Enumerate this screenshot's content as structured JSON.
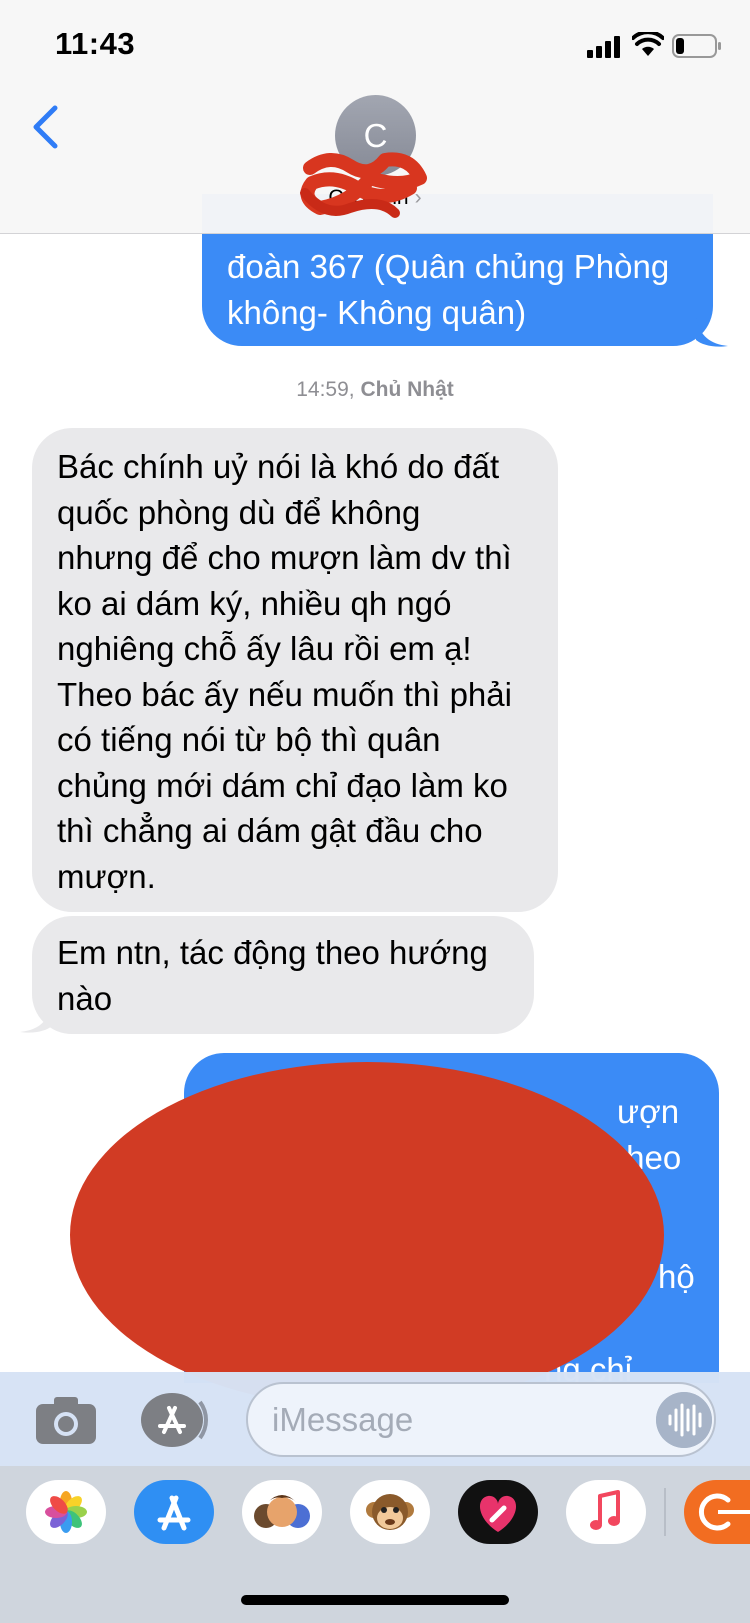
{
  "status_bar": {
    "time": "11:43"
  },
  "header": {
    "avatar_initial": "C",
    "contact_name": "C Thanh",
    "chevron": "›"
  },
  "messages": [
    {
      "direction": "outgoing",
      "text": "đoàn 367 (Quân chủng Phòng\nkhông- Không quân)"
    },
    {
      "direction": "incoming",
      "text": "Bác chính uỷ nói là khó do đất\nquốc phòng dù để không\nnhưng để cho mượn làm dv thì\nko ai dám ký, nhiều qh ngó\nnghiêng chỗ ấy lâu rồi em ạ!\nTheo bác ấy nếu muốn thì phải\ncó tiếng nói từ bộ thì quân\nchủng mới dám chỉ đạo làm ko\nthì chẳng ai dám gật đầu cho\nmượn."
    },
    {
      "direction": "incoming",
      "text": "Em ntn, tác động theo hướng\nnào"
    },
    {
      "direction": "outgoing",
      "text": ""
    }
  ],
  "timestamp": {
    "time": "14:59,",
    "day": "Chủ Nhật"
  },
  "visible_fragments": {
    "top_right": "ượn theo",
    "right_1": "hộ",
    "right_2": "ng chỉ"
  },
  "input": {
    "placeholder": "iMessage"
  },
  "icons": {
    "back": "chevron-left-icon",
    "camera": "camera-icon",
    "app_store": "app-store-icon",
    "voice": "waveform-icon",
    "signal": "cellular-signal-icon",
    "wifi": "wifi-icon",
    "battery": "battery-icon"
  },
  "app_drawer": [
    "Photos",
    "App Store",
    "Memoji",
    "Animoji",
    "Digital Touch",
    "Music",
    "Other app"
  ],
  "colors": {
    "outgoing_bubble": "#3b8bf6",
    "incoming_bubble": "#e9e9eb",
    "accent": "#2f7cf6",
    "redaction": "#d13b24"
  }
}
